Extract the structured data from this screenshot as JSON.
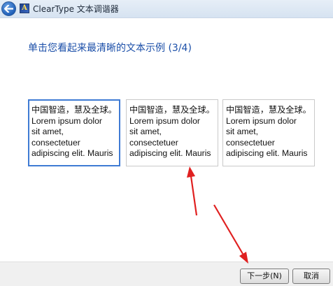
{
  "window": {
    "title": "ClearType 文本调谐器",
    "app_icon_glyph": "A",
    "back_icon": "back-arrow-icon"
  },
  "main": {
    "heading": "单击您看起来最清晰的文本示例 (3/4)"
  },
  "samples": [
    {
      "selected": true,
      "lines": [
        "中国智造，慧及全球。",
        "Lorem ipsum dolor",
        "sit amet,",
        "consectetuer",
        "adipiscing elit. Mauris"
      ]
    },
    {
      "selected": false,
      "lines": [
        "中国智造，慧及全球。",
        "Lorem ipsum dolor",
        "sit amet,",
        "consectetuer",
        "adipiscing elit. Mauris"
      ]
    },
    {
      "selected": false,
      "lines": [
        "中国智造，慧及全球。",
        "Lorem ipsum dolor",
        "sit amet,",
        "consectetuer",
        "adipiscing elit. Mauris"
      ]
    }
  ],
  "footer": {
    "next_label": "下一步(N)",
    "cancel_label": "取消"
  },
  "colors": {
    "heading": "#1a4ea8",
    "selected_border": "#3f7bd4",
    "annotation_arrow": "#e02020"
  }
}
